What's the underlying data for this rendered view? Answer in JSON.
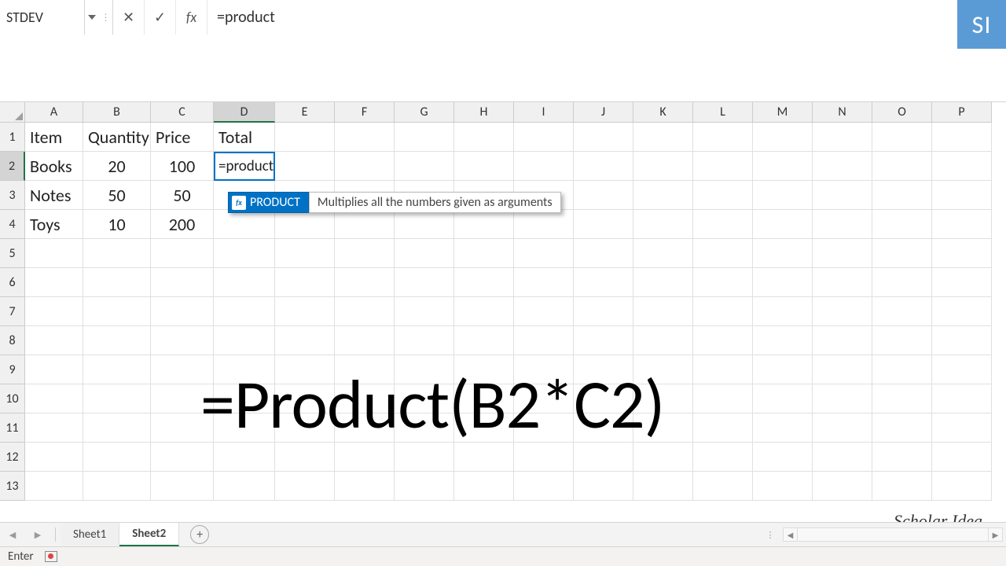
{
  "name_box": "STDEV",
  "formula_bar": "=product",
  "si_logo": "SI",
  "columns": [
    "A",
    "B",
    "C",
    "D",
    "E",
    "F",
    "G",
    "H",
    "I",
    "J",
    "K",
    "L",
    "M",
    "N",
    "O",
    "P"
  ],
  "selected_col": "D",
  "selected_row": "2",
  "row_numbers": [
    "1",
    "2",
    "3",
    "4",
    "5",
    "6",
    "7",
    "8",
    "9",
    "10",
    "11",
    "12",
    "13"
  ],
  "headers": {
    "A": "Item",
    "B": "Quantity",
    "C": "Price",
    "D": "Total"
  },
  "rows": [
    {
      "A": "Books",
      "B": "20",
      "C": "100",
      "D": "=product"
    },
    {
      "A": "Notes",
      "B": "50",
      "C": "50",
      "D": ""
    },
    {
      "A": "Toys",
      "B": "10",
      "C": "200",
      "D": ""
    }
  ],
  "autocomplete": {
    "func": "PRODUCT",
    "desc": "Multiplies all the numbers given as arguments"
  },
  "overlay": "=Product(B2*C2)",
  "watermark": "Scholar Idea",
  "tabs": {
    "sheet1": "Sheet1",
    "sheet2": "Sheet2"
  },
  "status": "Enter"
}
